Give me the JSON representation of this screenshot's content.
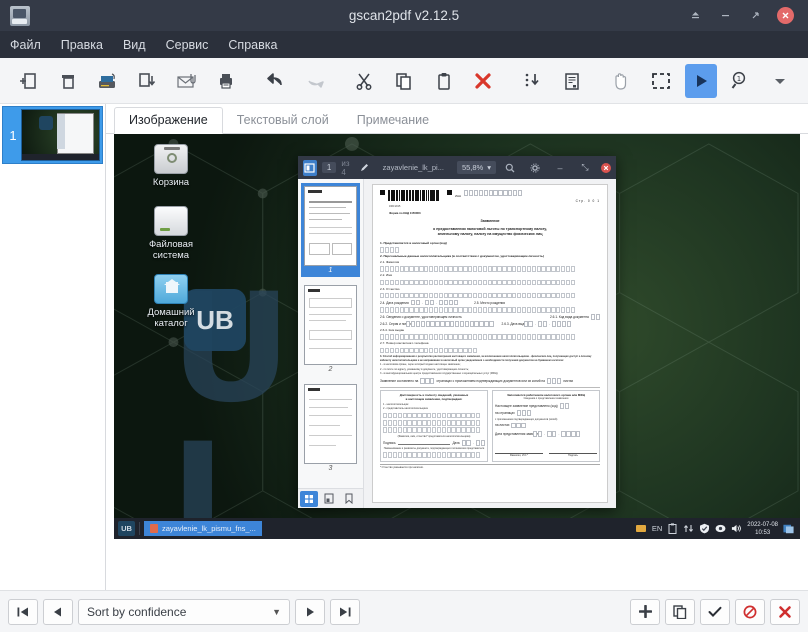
{
  "window": {
    "title": "gscan2pdf v2.12.5",
    "app_icon": "scanner-icon",
    "buttons": {
      "shade": "shade-window-button",
      "minimize": "minimize-button",
      "maximize": "maximize-button",
      "close": "close-button",
      "close_glyph": "✕",
      "shade_glyph": "▲",
      "minimize_glyph": "–",
      "maximize_glyph": "⤡"
    }
  },
  "menubar": {
    "items": [
      {
        "label": "Файл",
        "name": "menu-file"
      },
      {
        "label": "Правка",
        "name": "menu-edit"
      },
      {
        "label": "Вид",
        "name": "menu-view"
      },
      {
        "label": "Сервис",
        "name": "menu-tools"
      },
      {
        "label": "Справка",
        "name": "menu-help"
      }
    ]
  },
  "toolbar": {
    "items": [
      {
        "name": "new-icon",
        "glyph": "new"
      },
      {
        "name": "open-icon",
        "glyph": "open"
      },
      {
        "name": "scan-icon",
        "glyph": "scanner"
      },
      {
        "name": "save-icon",
        "glyph": "save"
      },
      {
        "name": "email-icon",
        "glyph": "email"
      },
      {
        "name": "print-icon",
        "glyph": "printer"
      },
      {
        "name": "undo-icon",
        "glyph": "undo"
      },
      {
        "name": "redo-icon",
        "glyph": "redo"
      },
      {
        "name": "cut-icon",
        "glyph": "scissors"
      },
      {
        "name": "copy-icon",
        "glyph": "copy"
      },
      {
        "name": "paste-icon",
        "glyph": "clipboard"
      },
      {
        "name": "delete-icon",
        "glyph": "red-x"
      },
      {
        "name": "select-all-icon",
        "glyph": "dotted-arrow-down"
      },
      {
        "name": "properties-icon",
        "glyph": "document-props"
      },
      {
        "name": "pan-tool-icon",
        "glyph": "hand"
      },
      {
        "name": "selector-tool-icon",
        "glyph": "dashed-rect"
      },
      {
        "name": "ocr-run-icon",
        "glyph": "blue-play",
        "active": true
      },
      {
        "name": "zoom-tool-icon",
        "glyph": "magnifier-one"
      },
      {
        "name": "overflow-icon",
        "glyph": "chevron-down"
      }
    ]
  },
  "thumbnails": {
    "pages": [
      {
        "number": "1",
        "selected": true
      }
    ]
  },
  "tabs": [
    {
      "label": "Изображение",
      "name": "tab-image",
      "active": true
    },
    {
      "label": "Текстовый слой",
      "name": "tab-text-layer",
      "active": false
    },
    {
      "label": "Примечание",
      "name": "tab-annotation",
      "active": false
    }
  ],
  "canvas": {
    "desktop": {
      "icons": [
        {
          "label": "Корзина",
          "name": "desktop-icon-trash"
        },
        {
          "label": "Файловая\nсистема",
          "name": "desktop-icon-filesystem"
        },
        {
          "label": "Домашний\nкаталог",
          "name": "desktop-icon-home"
        }
      ],
      "wallpaper_text": "UB",
      "taskbar": {
        "start_label": "UB",
        "task_label": "zayavlenie_lk_pismu_fns_...",
        "tray": {
          "layout": "EN",
          "date": "2022-07-08",
          "time": "10:53"
        }
      }
    },
    "pdf_viewer": {
      "sidebar_toggle": "sidebar-toggle",
      "page_current": "1",
      "page_of": "из 4",
      "edit_icon": "pencil-icon",
      "file_name": "zayavlenie_lk_pi...",
      "zoom_level": "55,8%",
      "search_icon": "search-icon",
      "settings_icon": "gear-icon",
      "minimize_glyph": "–",
      "maximize_glyph": "⤡",
      "close_glyph": "✕",
      "side_pages": [
        {
          "caption": "1",
          "selected": true
        },
        {
          "caption": "2",
          "selected": false
        },
        {
          "caption": "3",
          "selected": false
        }
      ],
      "side_footer": [
        {
          "name": "thumbnails-view-icon",
          "active": true
        },
        {
          "name": "outline-view-icon",
          "active": false
        },
        {
          "name": "bookmarks-view-icon",
          "active": false
        }
      ],
      "document": {
        "page_label": "Стр. 0 0 1",
        "inn_label": "ИНН",
        "barcode_digits": "1660   2015",
        "form_code": "Форма по КНД 1150063",
        "title_line1": "Заявление",
        "title_line2": "о предоставлении налоговой льготы по транспортному налогу,",
        "title_line3": "земельному налогу, налогу на имущество физических лиц",
        "fields": [
          "1. Представляется в налоговый орган (код)",
          "2. Персональные данные налогоплательщика (в соответствии с документом, удостоверяющим личность)",
          "2.1. Фамилия",
          "2.2. Имя",
          "2.3. Отчество",
          "2.4. Дата рождения",
          "2.5. Место рождения",
          "2.6. Сведения о документе, удостоверяющем личность",
          "2.6.1. Код вида документа",
          "2.6.2. Серия и номер",
          "2.6.3. Дата выдачи",
          "2.6.4. Кем выдан",
          "2.7. Номер контактного телефона"
        ],
        "section3_head": "3. Способ информирования о результатах рассмотрения настоящего заявления, за исключением налогоплательщиков - физических лиц, получающих доступ к личному кабинету налогоплательщика и не направивших в налоговый орган уведомления о необходимости получения документов на бумажном носителе:",
        "section3_items": [
          "1 - в налоговом органе, через который подано настоящее заявление;",
          "2 - по почте по адресу, указанному в документе, удостоверяющем личность;",
          "3 - в многофункциональном центре предоставления государственных и муниципальных услуг (МФЦ)."
        ],
        "submit_line": "Заявление составлено на",
        "submit_line2": "страницах с приложением подтверждающих документов или их копий на",
        "submit_line3": "листах",
        "left_col_head1": "Достоверность и полноту сведений, указанных",
        "left_col_head2": "в настоящем заявлении, подтверждаю:",
        "left_col_items": [
          "1 - налогоплательщик",
          "2 - представитель налогоплательщика"
        ],
        "left_col_note": "(Фамилия, имя, отчество* представителя налогоплательщика)",
        "left_sign": "Подпись",
        "left_date": "Дата",
        "left_col_note2": "Наименование и реквизиты документа, подтверждающего полномочия представителя",
        "right_col_head": "Заполняется работником налогового органа или МФЦ",
        "right_col_sub": "Сведения о представлении заявления",
        "right_col_items": [
          "Настоящее заявление представлено (код)",
          "на                           страницах",
          "с приложением подтверждающих документов (копий)",
          "на                           листах",
          "Дата представления заявления"
        ],
        "right_sign1": "Фамилия, И.О.*",
        "right_sign2": "Подпись",
        "footnote": "* Отчество указывается при наличии."
      }
    }
  },
  "bottombar": {
    "first_glyph": "❘◀",
    "prev_glyph": "◀",
    "sort_label": "Sort by confidence",
    "caret": "▼",
    "next_glyph": "▶",
    "last_glyph": "▶❘",
    "add_glyph": "✚",
    "copy_glyph": "⧉",
    "ok_glyph": "✔",
    "reject_glyph": "⃠",
    "delete_glyph": "✖",
    "buttons": [
      {
        "name": "first-page-button"
      },
      {
        "name": "previous-page-button"
      },
      {
        "name": "sort-dropdown"
      },
      {
        "name": "next-page-button"
      },
      {
        "name": "last-page-button"
      },
      {
        "name": "add-box-button"
      },
      {
        "name": "duplicate-box-button"
      },
      {
        "name": "confirm-button"
      },
      {
        "name": "reject-button"
      },
      {
        "name": "delete-button"
      }
    ]
  },
  "colors": {
    "titlebar": "#343a47",
    "menubar": "#2b303b",
    "accent_blue": "#5c9ded",
    "close_red": "#e36a6a",
    "toolbar_bg": "#f4f5f7"
  }
}
